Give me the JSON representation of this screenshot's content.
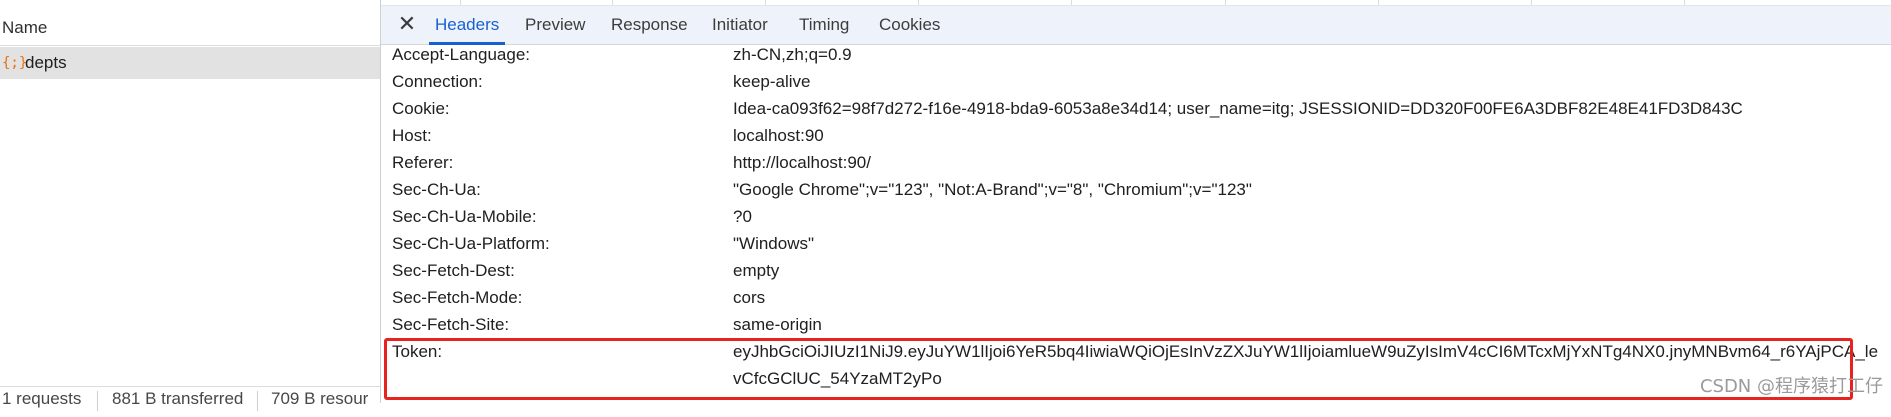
{
  "request_list": {
    "header": "Name",
    "items": [
      {
        "icon": "json-file-icon",
        "name": "depts"
      }
    ]
  },
  "status_bar": {
    "requests": "1 requests",
    "transferred": "881 B transferred",
    "resources": "709 B resour"
  },
  "detail_tabs": {
    "close_label": "✕",
    "tabs": [
      "Headers",
      "Preview",
      "Response",
      "Initiator",
      "Timing",
      "Cookies"
    ],
    "active": "Headers"
  },
  "headers": [
    {
      "name": "Accept-Language:",
      "value": "zh-CN,zh;q=0.9"
    },
    {
      "name": "Connection:",
      "value": "keep-alive"
    },
    {
      "name": "Cookie:",
      "value": "Idea-ca093f62=98f7d272-f16e-4918-bda9-6053a8e34d14; user_name=itg; JSESSIONID=DD320F00FE6A3DBF82E48E41FD3D843C"
    },
    {
      "name": "Host:",
      "value": "localhost:90"
    },
    {
      "name": "Referer:",
      "value": "http://localhost:90/"
    },
    {
      "name": "Sec-Ch-Ua:",
      "value": "\"Google Chrome\";v=\"123\", \"Not:A-Brand\";v=\"8\", \"Chromium\";v=\"123\""
    },
    {
      "name": "Sec-Ch-Ua-Mobile:",
      "value": "?0"
    },
    {
      "name": "Sec-Ch-Ua-Platform:",
      "value": "\"Windows\""
    },
    {
      "name": "Sec-Fetch-Dest:",
      "value": "empty"
    },
    {
      "name": "Sec-Fetch-Mode:",
      "value": "cors"
    },
    {
      "name": "Sec-Fetch-Site:",
      "value": "same-origin"
    },
    {
      "name": "Token:",
      "value_line1": "eyJhbGciOiJIUzI1NiJ9.eyJuYW1lIjoi6YeR5bq4IiwiaWQiOjEsInVzZXJuYW1lIjoiamlueW9uZyIsImV4cCI6MTcxMjYxNTg4NX0.jnyMNBvm64_r6YAjPCA_le",
      "value_line2": "vCfcGClUC_54YzaMT2yPo"
    }
  ],
  "highlight_color": "#e8231f",
  "accent_color": "#1a5fd0",
  "watermark": "CSDN @程序猿打工仔"
}
